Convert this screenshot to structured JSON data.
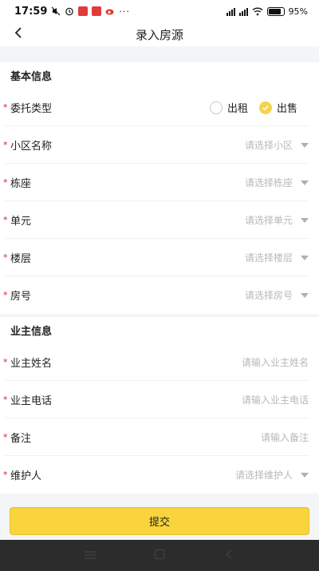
{
  "status_bar": {
    "time": "17:59",
    "battery": "95%"
  },
  "header": {
    "title": "录入房源",
    "back_icon": "chevron-left-icon"
  },
  "sections": {
    "basic": {
      "title": "基本信息",
      "entrust_type": {
        "label": "委托类型",
        "options": [
          "出租",
          "出售"
        ],
        "selected": "出售"
      },
      "community": {
        "label": "小区名称",
        "placeholder": "请选择小区"
      },
      "building": {
        "label": "栋座",
        "placeholder": "请选择栋座"
      },
      "unit": {
        "label": "单元",
        "placeholder": "请选择单元"
      },
      "floor": {
        "label": "楼层",
        "placeholder": "请选择楼层"
      },
      "room": {
        "label": "房号",
        "placeholder": "请选择房号"
      }
    },
    "owner": {
      "title": "业主信息",
      "name": {
        "label": "业主姓名",
        "placeholder": "请输入业主姓名"
      },
      "phone": {
        "label": "业主电话",
        "placeholder": "请输入业主电话"
      },
      "remark": {
        "label": "备注",
        "placeholder": "请输入备注"
      },
      "maintainer": {
        "label": "维护人",
        "placeholder": "请选择维护人"
      }
    }
  },
  "required_mark": "*",
  "submit_label": "提交",
  "colors": {
    "accent": "#f9d43c",
    "required": "#e02020",
    "placeholder": "#b8b8b8"
  }
}
